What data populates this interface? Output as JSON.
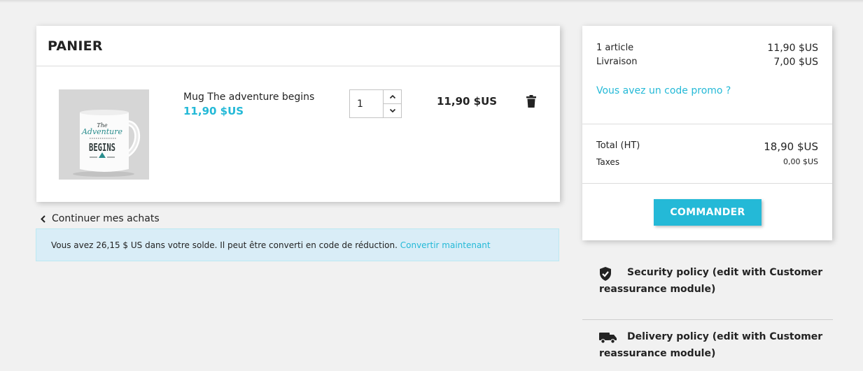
{
  "colors": {
    "accent": "#24b9d7",
    "alert_bg": "#d9edf7",
    "text": "#232323",
    "page_bg": "#f1f1f1"
  },
  "cart": {
    "title": "PANIER",
    "item": {
      "name": "Mug The adventure begins",
      "price": "11,90 $US",
      "quantity": "1",
      "line_total": "11,90 $US",
      "image_text": {
        "top": "The",
        "middle": "Adventure",
        "bottom": "BEGINS"
      }
    },
    "continue_label": "Continuer mes achats",
    "voucher_alert": {
      "text": "Vous avez 26,15 $ US dans votre solde. Il peut être converti en code de réduction.",
      "link": "Convertir maintenant"
    }
  },
  "summary": {
    "items_label": "1 article",
    "items_value": "11,90 $US",
    "shipping_label": "Livraison",
    "shipping_value": "7,00 $US",
    "promo_link": "Vous avez un code promo ?",
    "total_label": "Total (HT)",
    "total_value": "18,90 $US",
    "taxes_label": "Taxes",
    "taxes_value": "0,00 $US",
    "checkout_label": "COMMANDER"
  },
  "reassurance": [
    {
      "icon": "shield-check-icon",
      "text": "Security policy (edit with Customer reassurance module)"
    },
    {
      "icon": "truck-icon",
      "text": "Delivery policy (edit with Customer reassurance module)"
    }
  ]
}
